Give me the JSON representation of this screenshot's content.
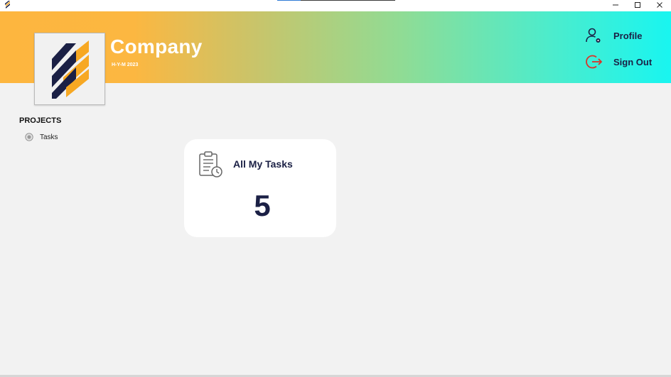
{
  "window": {
    "progress_fraction": 0.2,
    "controls": {
      "minimize": "—",
      "maximize": "☐",
      "close": "✕"
    }
  },
  "header": {
    "company_name": "Company",
    "company_subtitle": "H-Y-M 2023",
    "profile_label": "Profile",
    "signout_label": "Sign Out",
    "icons": {
      "profile": "user-gear-icon",
      "signout": "logout-icon",
      "logo": "striped-s-logo"
    },
    "colors": {
      "gradient_start": "#fdb63f",
      "gradient_end": "#19f5f0",
      "accent_red": "#d8352b",
      "navy": "#1b2045",
      "logo_orange": "#f7a823"
    }
  },
  "sidebar": {
    "section_title": "PROJECTS",
    "items": [
      {
        "label": "Tasks",
        "icon": "radio-bullet-icon"
      }
    ]
  },
  "main": {
    "card": {
      "title": "All My Tasks",
      "count": "5",
      "icon": "clipboard-clock-icon"
    }
  }
}
